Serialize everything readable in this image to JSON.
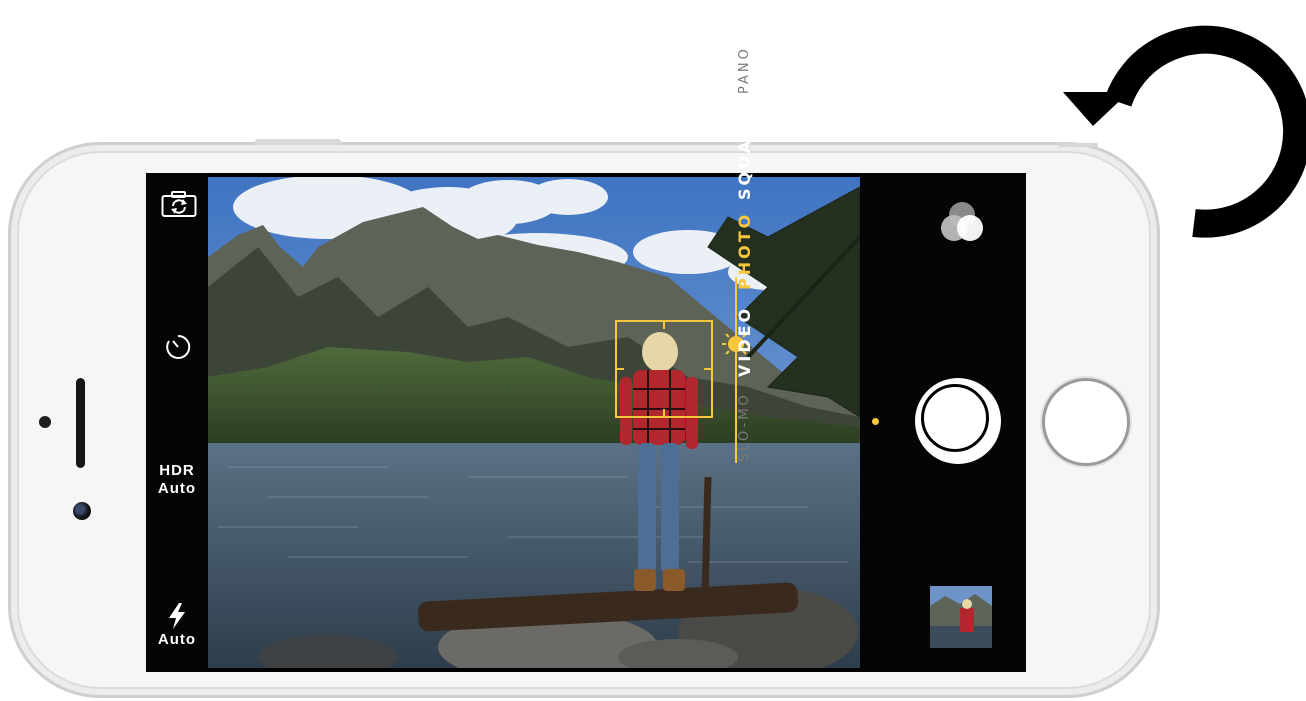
{
  "camera": {
    "left_bar": {
      "hdr_label_line1": "HDR",
      "hdr_label_line2": "Auto",
      "flash_label": "Auto",
      "switch_camera_icon": "camera-switch-icon",
      "timer_icon": "timer-icon",
      "flash_icon": "lightning-icon"
    },
    "modes": [
      {
        "label": "SLO-MO",
        "state": "dim"
      },
      {
        "label": "VIDEO",
        "state": "normal"
      },
      {
        "label": "PHOTO",
        "state": "active"
      },
      {
        "label": "SQUARE",
        "state": "normal"
      },
      {
        "label": "PANO",
        "state": "dim"
      }
    ],
    "right_bar": {
      "filters_icon": "filters-icon",
      "shutter_icon": "shutter-button",
      "thumbnail_icon": "last-photo-thumbnail"
    },
    "viewfinder": {
      "focus_box": "focus-square",
      "exposure_icon": "sun-icon"
    }
  },
  "colors": {
    "accent": "#f8c73a",
    "screen_bg": "#050505",
    "phone_body": "#f6f6f6"
  },
  "overlay": {
    "rotate_icon": "rotate-counterclockwise-icon"
  }
}
